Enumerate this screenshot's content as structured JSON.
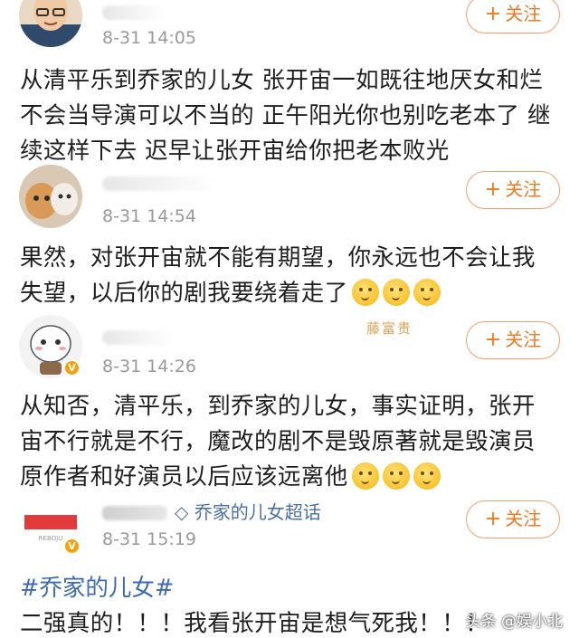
{
  "comments": [
    {
      "time": "8-31 14:05",
      "follow_label": "关注",
      "follow_plus": "+",
      "text": "从清平乐到乔家的儿女 张开宙一如既往地厌女和烂\n不会当导演可以不当的 正午阳光你也别吃老本了 继\n续这样下去 迟早让张开宙给你把老本败光",
      "avatar": "bald-man-avatar"
    },
    {
      "time": "8-31 14:54",
      "follow_label": "关注",
      "follow_plus": "+",
      "text": "果然，对张开宙就不能有期望，你永远也不会让我\n失望，以后你的剧我要绕着走了",
      "emoji_count": 3,
      "avatar": "cats-avatar"
    },
    {
      "time": "8-31 14:26",
      "follow_label": "关注",
      "follow_plus": "+",
      "verified_badge": "V",
      "header_deco": "藤富贵",
      "text": "从知否，清平乐，到乔家的儿女，事实证明，张开\n宙不行就是不行，魔改的剧不是毁原著就是毁演员\n原作者和好演员以后应该远离他",
      "emoji_count": 3,
      "avatar": "cartoon-avatar"
    },
    {
      "time": "8-31 15:19",
      "follow_label": "关注",
      "follow_plus": "+",
      "verified_badge": "V",
      "topic_icon": "diamond-icon",
      "topic": "乔家的儿女超话",
      "hashtag": "#乔家的儿女#",
      "text": "二强真的！！！我看张开宙是想气死我！！！",
      "avatar": "rebdju-avatar",
      "avatar_text": "REBOJU"
    }
  ],
  "watermark": "头条 @娱小北",
  "colors": {
    "accent": "#f0781e",
    "link": "#3d6ab0",
    "time": "#999999",
    "badge": "#f4a20c"
  }
}
